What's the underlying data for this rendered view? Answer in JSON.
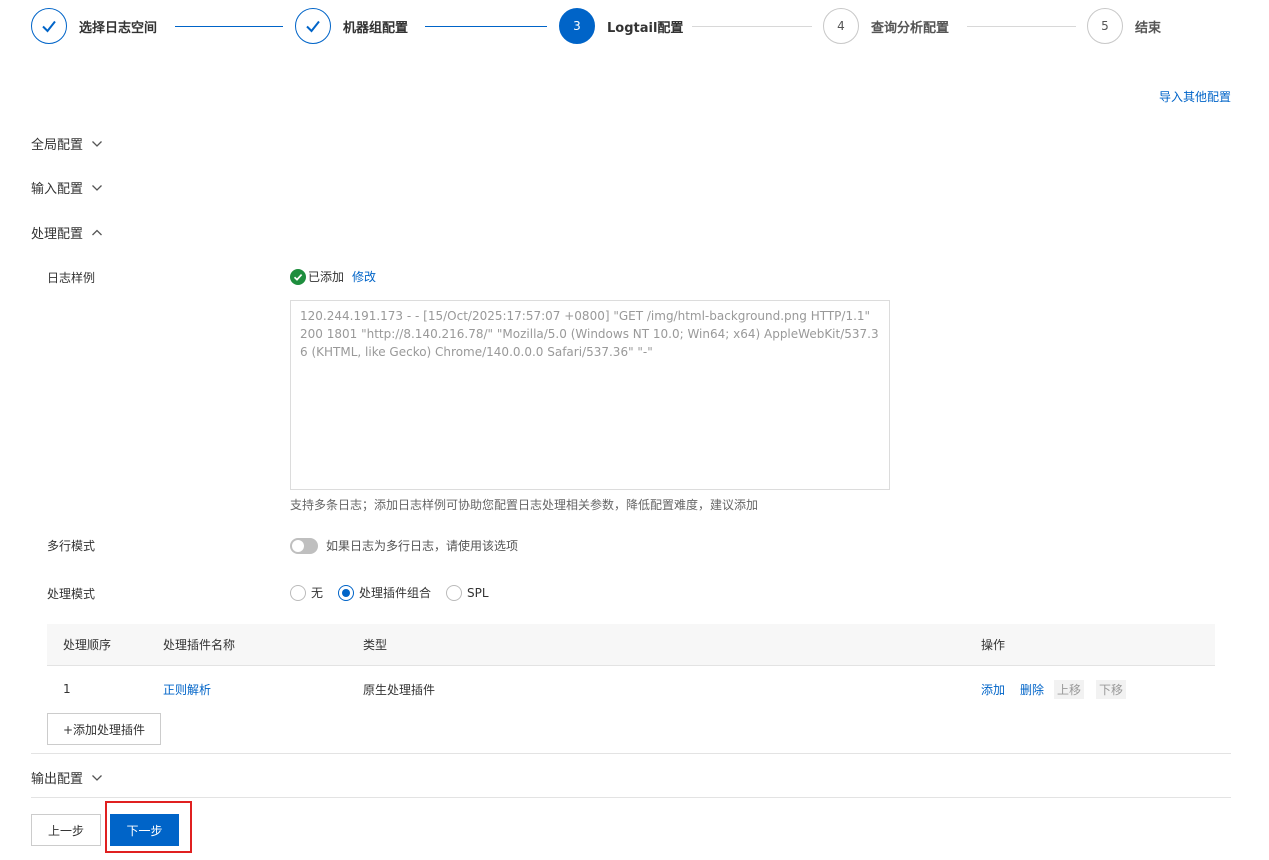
{
  "steps": [
    {
      "label": "选择日志空间",
      "state": "done"
    },
    {
      "label": "机器组配置",
      "state": "done"
    },
    {
      "num": "3",
      "label": "Logtail配置",
      "state": "active"
    },
    {
      "num": "4",
      "label": "查询分析配置",
      "state": "todo"
    },
    {
      "num": "5",
      "label": "结束",
      "state": "todo"
    }
  ],
  "import_link": "导入其他配置",
  "sections": {
    "global": "全局配置",
    "input": "输入配置",
    "process": "处理配置",
    "output": "输出配置"
  },
  "process": {
    "sample_label": "日志样例",
    "sample_status": "已添加",
    "sample_modify": "修改",
    "sample_text": "120.244.191.173 - - [15/Oct/2025:17:57:07 +0800] \"GET /img/html-background.png HTTP/1.1\" 200 1801 \"http://8.140.216.78/\" \"Mozilla/5.0 (Windows NT 10.0; Win64; x64) AppleWebKit/537.36 (KHTML, like Gecko) Chrome/140.0.0.0 Safari/537.36\" \"-\"",
    "sample_hint": "支持多条日志；添加日志样例可协助您配置日志处理相关参数，降低配置难度，建议添加",
    "multiline_label": "多行模式",
    "multiline_hint": "如果日志为多行日志，请使用该选项",
    "mode_label": "处理模式",
    "mode_options": [
      "无",
      "处理插件组合",
      "SPL"
    ],
    "mode_selected": "处理插件组合",
    "table_headers": [
      "处理顺序",
      "处理插件名称",
      "类型",
      "操作"
    ],
    "rows": [
      {
        "order": "1",
        "name": "正则解析",
        "type": "原生处理插件",
        "ops": [
          "添加",
          "删除",
          "上移",
          "下移"
        ]
      }
    ],
    "add_plugin": "+添加处理插件"
  },
  "footer": {
    "prev": "上一步",
    "next": "下一步"
  },
  "colors": {
    "primary": "#0064c8",
    "success": "#1e8e3e",
    "highlight": "#e02020"
  }
}
